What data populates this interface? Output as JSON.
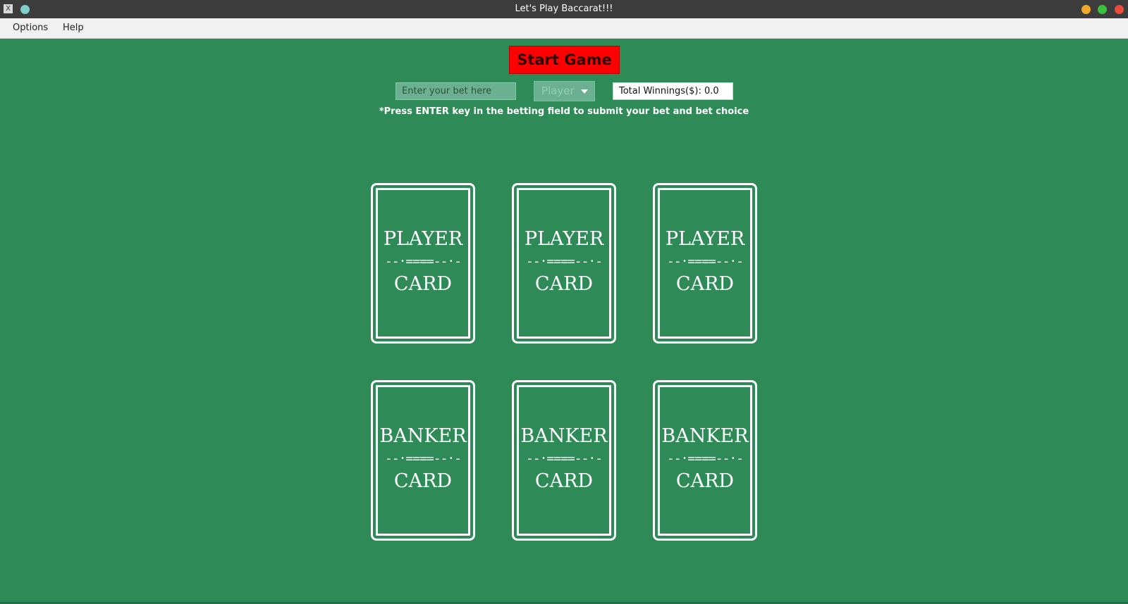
{
  "window": {
    "title": "Let's Play Baccarat!!!",
    "app_icon": "x11-icon",
    "colors": {
      "minimize": "#f2a82a",
      "maximize": "#3cc13e",
      "close": "#ee4b3f"
    }
  },
  "menubar": {
    "items": [
      {
        "label": "Options"
      },
      {
        "label": "Help"
      }
    ]
  },
  "controls": {
    "start_button_label": "Start Game",
    "bet_input_placeholder": "Enter your bet here",
    "bet_input_value": "",
    "bet_choice_selected": "Player",
    "winnings_text": "Total Winnings($): 0.0",
    "hint": "*Press ENTER key in the betting field to submit your bet and bet choice"
  },
  "cards": {
    "player": [
      {
        "top": "PLAYER",
        "divider": "--·====--·-",
        "bottom": "CARD"
      },
      {
        "top": "PLAYER",
        "divider": "--·====--·-",
        "bottom": "CARD"
      },
      {
        "top": "PLAYER",
        "divider": "--·====--·-",
        "bottom": "CARD"
      }
    ],
    "banker": [
      {
        "top": "BANKER",
        "divider": "--·====--·-",
        "bottom": "CARD"
      },
      {
        "top": "BANKER",
        "divider": "--·====--·-",
        "bottom": "CARD"
      },
      {
        "top": "BANKER",
        "divider": "--·====--·-",
        "bottom": "CARD"
      }
    ]
  },
  "theme": {
    "table_green": "#2e8b57",
    "start_button_red": "#ff0000"
  }
}
